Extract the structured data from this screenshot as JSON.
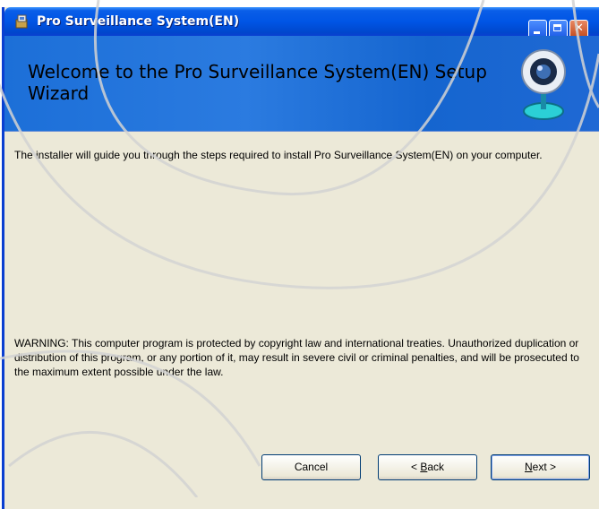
{
  "window": {
    "title": "Pro Surveillance System(EN)"
  },
  "banner": {
    "title": "Welcome to the Pro Surveillance System(EN) Setup Wizard"
  },
  "body": {
    "intro": "The installer will guide you through the steps required to install Pro Surveillance System(EN) on your computer.",
    "warning": "WARNING: This computer program is protected by copyright law and international treaties. Unauthorized duplication or distribution of this program, or any portion of it, may result in severe civil or criminal penalties, and will be prosecuted to the maximum extent possible under the law."
  },
  "buttons": {
    "cancel": "Cancel",
    "back_prefix": "< ",
    "back_accel": "B",
    "back_rest": "ack",
    "next_accel": "N",
    "next_rest": "ext >"
  },
  "icons": {
    "app": "installer-icon",
    "banner": "webcam-icon",
    "titlebar": [
      "minimize-icon",
      "maximize-icon",
      "close-icon"
    ]
  },
  "colors": {
    "titlebar": "#0055e5",
    "banner": "#1c6fd8",
    "dialog_bg": "#ece9d8"
  }
}
